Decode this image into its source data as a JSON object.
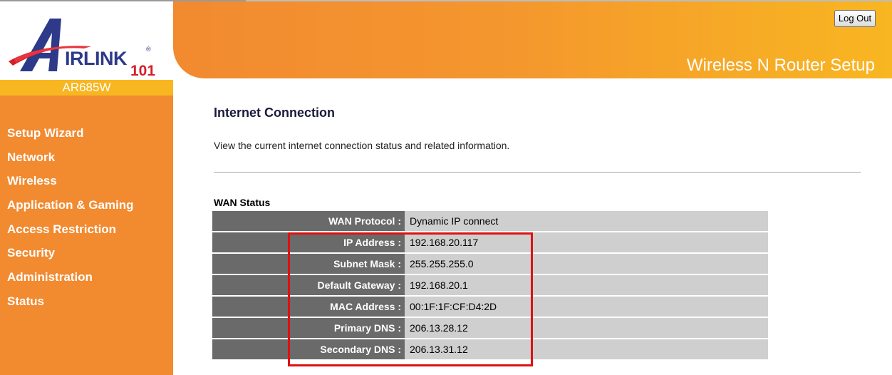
{
  "brand": {
    "logo_main": "IRLINK",
    "logo_number": "101",
    "model": "AR685W"
  },
  "header": {
    "logout_label": "Log Out",
    "title": "Wireless N Router Setup"
  },
  "nav": {
    "items": [
      {
        "label": "Setup Wizard"
      },
      {
        "label": "Network"
      },
      {
        "label": "Wireless"
      },
      {
        "label": "Application & Gaming"
      },
      {
        "label": "Access Restriction"
      },
      {
        "label": "Security"
      },
      {
        "label": "Administration"
      },
      {
        "label": "Status"
      }
    ]
  },
  "main": {
    "title": "Internet Connection",
    "description": "View the current internet connection status and related information.",
    "section_title": "WAN Status",
    "rows": [
      {
        "label": "WAN Protocol :",
        "value": "Dynamic IP connect"
      },
      {
        "label": "IP Address :",
        "value": "192.168.20.117"
      },
      {
        "label": "Subnet Mask :",
        "value": "255.255.255.0"
      },
      {
        "label": "Default Gateway :",
        "value": "192.168.20.1"
      },
      {
        "label": "MAC Address :",
        "value": "00:1F:1F:CF:D4:2D"
      },
      {
        "label": "Primary DNS :",
        "value": "206.13.28.12"
      },
      {
        "label": "Secondary DNS :",
        "value": "206.13.31.12"
      }
    ]
  },
  "colors": {
    "sidebar": "#f28a30",
    "header_gradient_end": "#f8b621",
    "label_cell": "#6a6a6a",
    "value_cell": "#cfcfcf",
    "highlight": "#e01010"
  }
}
